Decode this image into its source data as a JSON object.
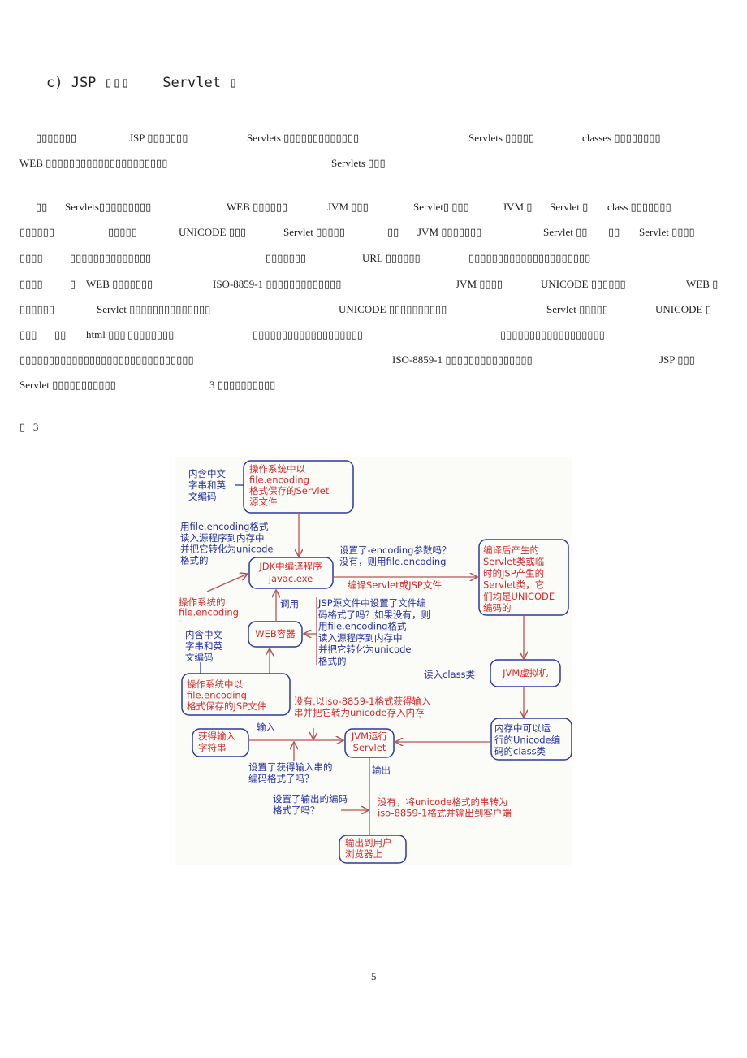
{
  "section_title": "c) JSP ▯▯▯    Servlet ▯",
  "body_lines": [
    [
      "▯▯▯▯▯▯▯",
      "JSP ▯▯▯▯▯▯▯",
      "Servlets ▯▯▯▯▯▯▯▯▯▯▯▯▯",
      "Servlets ▯▯▯▯▯",
      "classes ▯▯▯▯▯▯▯▯"
    ],
    [
      "WEB ▯▯▯▯▯▯▯▯▯▯▯▯▯▯▯▯▯▯▯▯▯",
      "Servlets ▯▯▯"
    ],
    [
      "▯▯",
      "Servlets▯▯▯▯▯▯▯▯▯",
      "WEB ▯▯▯▯▯▯",
      "JVM ▯▯▯",
      "Servlet▯ ▯▯▯",
      "JVM ▯",
      "Servlet ▯",
      "class ▯▯▯▯▯▯▯"
    ],
    [
      "▯▯▯▯▯▯",
      "▯▯▯▯▯",
      "UNICODE ▯▯▯",
      "Servlet ▯▯▯▯▯",
      "▯▯",
      "JVM ▯▯▯▯▯▯▯",
      "Servlet ▯▯",
      "▯▯",
      "Servlet ▯▯▯▯"
    ],
    [
      "▯▯▯▯",
      "▯▯▯▯▯▯▯▯▯▯▯▯▯▯",
      "▯▯▯▯▯▯▯",
      "URL ▯▯▯▯▯▯",
      "▯▯▯▯▯▯▯▯▯▯▯▯▯▯▯▯▯▯▯▯▯"
    ],
    [
      "▯▯▯▯",
      "▯",
      "WEB ▯▯▯▯▯▯▯",
      "ISO-8859-1 ▯▯▯▯▯▯▯▯▯▯▯▯▯",
      "JVM ▯▯▯▯",
      "UNICODE ▯▯▯▯▯▯",
      "WEB ▯"
    ],
    [
      "▯▯▯▯▯▯",
      "Servlet ▯▯▯▯▯▯▯▯▯▯▯▯▯▯",
      "UNICODE ▯▯▯▯▯▯▯▯▯▯",
      "Servlet ▯▯▯▯▯",
      "UNICODE ▯"
    ],
    [
      "▯▯▯",
      "▯▯",
      "html ▯▯▯",
      "▯▯▯▯▯▯▯▯",
      "▯▯▯▯▯▯▯▯▯▯▯▯▯▯▯▯▯▯▯",
      "▯▯▯▯▯▯▯▯▯▯▯▯▯▯▯▯▯▯"
    ],
    [
      "▯▯▯▯▯▯▯▯▯▯▯▯▯▯▯▯▯▯▯▯▯▯▯▯▯▯▯▯▯▯",
      "ISO-8859-1 ▯▯▯▯▯▯▯▯▯▯▯▯▯▯▯",
      "JSP ▯▯▯"
    ],
    [
      "Servlet ▯▯▯▯▯▯▯▯▯▯▯",
      "3 ▯▯▯▯▯▯▯▯▯▯"
    ],
    [
      "▯   3"
    ]
  ],
  "page_number": "5",
  "diagram": {
    "colors": {
      "red_text": "#d42a2a",
      "blue_text": "#2330a0",
      "box_border": "#2d3a9c",
      "arrow": "#b85555"
    },
    "note_servlet_src": [
      "内含中文",
      "字串和英",
      "文编码"
    ],
    "servlet_source_box": [
      "操作系统中以",
      "file.encoding",
      "格式保存的Servlet",
      "源文件"
    ],
    "read_note_1": [
      "用file.encoding格式",
      "读入源程序到内存中",
      "并把它转化为unicode",
      "格式的"
    ],
    "compiler_box": [
      "JDK中编译程序",
      "javac.exe"
    ],
    "encoding_question": [
      "设置了-encoding参数吗？",
      "没有，则用file.encoding"
    ],
    "compile_label": "编译Servlet或JSP文件",
    "class_box": [
      "编译后产生的",
      "Servlet类或临",
      "时的JSP产生的",
      "Servlet类，它",
      "们均是UNICODE",
      "编码的"
    ],
    "os_encoding": [
      "操作系统的",
      "file.encoding"
    ],
    "invoke_label": "调用",
    "jsp_note": [
      "JSP源文件中设置了文件编",
      "码格式了吗？如果没有，则",
      "用file.encoding格式",
      "读入源程序到内存中",
      "并把它转化为unicode",
      "格式的"
    ],
    "web_container_box": "WEB容器",
    "note_jsp_src": [
      "内含中文",
      "字串和英",
      "文编码"
    ],
    "jsp_source_box": [
      "操作系统中以",
      "file.encoding",
      "格式保存的JSP文件"
    ],
    "read_class_label": "读入class类",
    "jvm_box": "JVM虚拟机",
    "memory_box": [
      "内存中可以运",
      "行的Unicode编",
      "码的class类"
    ],
    "input_default_note": [
      "没有,以iso-8859-1格式获得输入",
      "串并把它转为unicode存入内存"
    ],
    "input_label": "输入",
    "get_input_box": [
      "获得输入",
      "字符串"
    ],
    "jvm_run_box": [
      "JVM运行",
      "Servlet"
    ],
    "input_question": [
      "设置了获得输入串的",
      "编码格式了吗？"
    ],
    "output_label": "输出",
    "output_question": [
      "设置了输出的编码",
      "格式了吗？"
    ],
    "output_default_note": [
      "没有，将unicode格式的串转为",
      "iso-8859-1格式并输出到客户端"
    ],
    "browser_box": [
      "输出到用户",
      "浏览器上"
    ]
  }
}
